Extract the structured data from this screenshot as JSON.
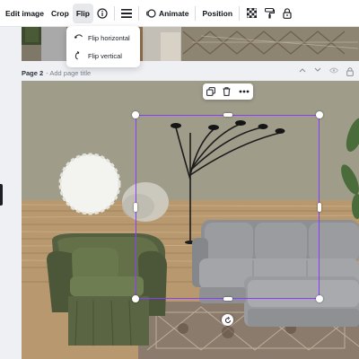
{
  "toolbar": {
    "edit_image": "Edit image",
    "crop": "Crop",
    "flip": "Flip",
    "info_icon": "info-icon",
    "position_icon": "lines-icon",
    "animate": "Animate",
    "position": "Position",
    "transparency_icon": "checkerboard-icon",
    "style_icon": "paint-roller-icon",
    "lock_icon": "lock-icon"
  },
  "flip_menu": {
    "horizontal": "Flip horizontal",
    "vertical": "Flip vertical"
  },
  "page": {
    "title": "Page 2",
    "subtitle": "- Add page title"
  },
  "selection": {
    "color": "#8b3dff",
    "toolbar_icons": [
      "copy-icon",
      "trash-icon",
      "more-icon"
    ]
  }
}
